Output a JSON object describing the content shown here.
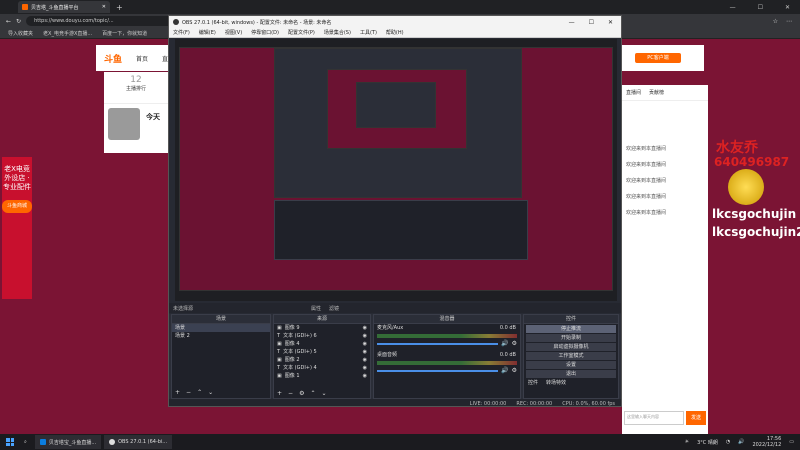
{
  "browser": {
    "tab_title": "贝吉塔_斗鱼直播平台",
    "url": "https://www.douyu.com/topic/...",
    "bookmarks": [
      "导入收藏夹",
      "老X_电竞手游X直播...",
      "百度一下，你就知道"
    ]
  },
  "site": {
    "logo": "斗鱼",
    "nav": [
      "首页",
      "直播"
    ],
    "left_count": "12",
    "left_label": "主播排行",
    "banner_text": "今天",
    "side_banner": "老X电竞外设店 · 专业配件",
    "side_button": "斗鱼商城",
    "right_tabs": [
      "直播间",
      "贡献榜"
    ],
    "right_button": "PC客户端",
    "danmu_1": "水友乔",
    "danmu_2": "640496987",
    "danmu_3": "lkcsgochujin",
    "danmu_4": "lkcsgochujin2",
    "chat_lines": [
      "欢迎来到本直播间",
      "欢迎来到本直播间",
      "欢迎来到本直播间",
      "欢迎来到本直播间",
      "欢迎来到本直播间"
    ],
    "input_placeholder": "这里输入聊天内容",
    "send": "发送"
  },
  "obs": {
    "title": "OBS 27.0.1 (64-bit, windows) - 配置文件: 未命名 - 场景: 未命名",
    "menu": [
      "文件(F)",
      "编辑(E)",
      "视图(V)",
      "停靠窗口(D)",
      "配置文件(P)",
      "场景集合(S)",
      "工具(T)",
      "帮助(H)"
    ],
    "no_source": "未选择源",
    "props": "属性",
    "filters": "滤镜",
    "docks": {
      "scenes": {
        "title": "场景",
        "items": [
          "场景",
          "场景 2"
        ]
      },
      "sources": {
        "title": "来源",
        "items": [
          "图像 9",
          "文本 (GDI+) 6",
          "图像 4",
          "文本 (GDI+) 5",
          "图像 2",
          "文本 (GDI+) 4",
          "图像 1"
        ]
      },
      "mixer": {
        "title": "混音器",
        "ch1": "麦克风/Aux",
        "ch1_db": "0.0 dB",
        "ch2": "桌面音频",
        "ch2_db": "0.0 dB"
      },
      "controls": {
        "title": "控件",
        "buttons": [
          "停止推流",
          "开始录制",
          "启动虚拟摄像机",
          "工作室模式",
          "设置",
          "退出"
        ],
        "bottom_tabs": [
          "控件",
          "转场特效"
        ]
      }
    },
    "status": {
      "live": "LIVE: 00:00:00",
      "rec": "REC: 00:00:00",
      "cpu": "CPU: 0.0%, 60.00 fps"
    }
  },
  "taskbar": {
    "items": [
      "贝吉塔宝_斗鱼直播...",
      "OBS 27.0.1 (64-bi..."
    ],
    "weather": "3°C 晴朗",
    "time": "17:56",
    "date": "2022/12/12"
  },
  "colors": {
    "page_bg": "#7b1434",
    "obs_bg": "#272a33",
    "accent": "#f60"
  }
}
